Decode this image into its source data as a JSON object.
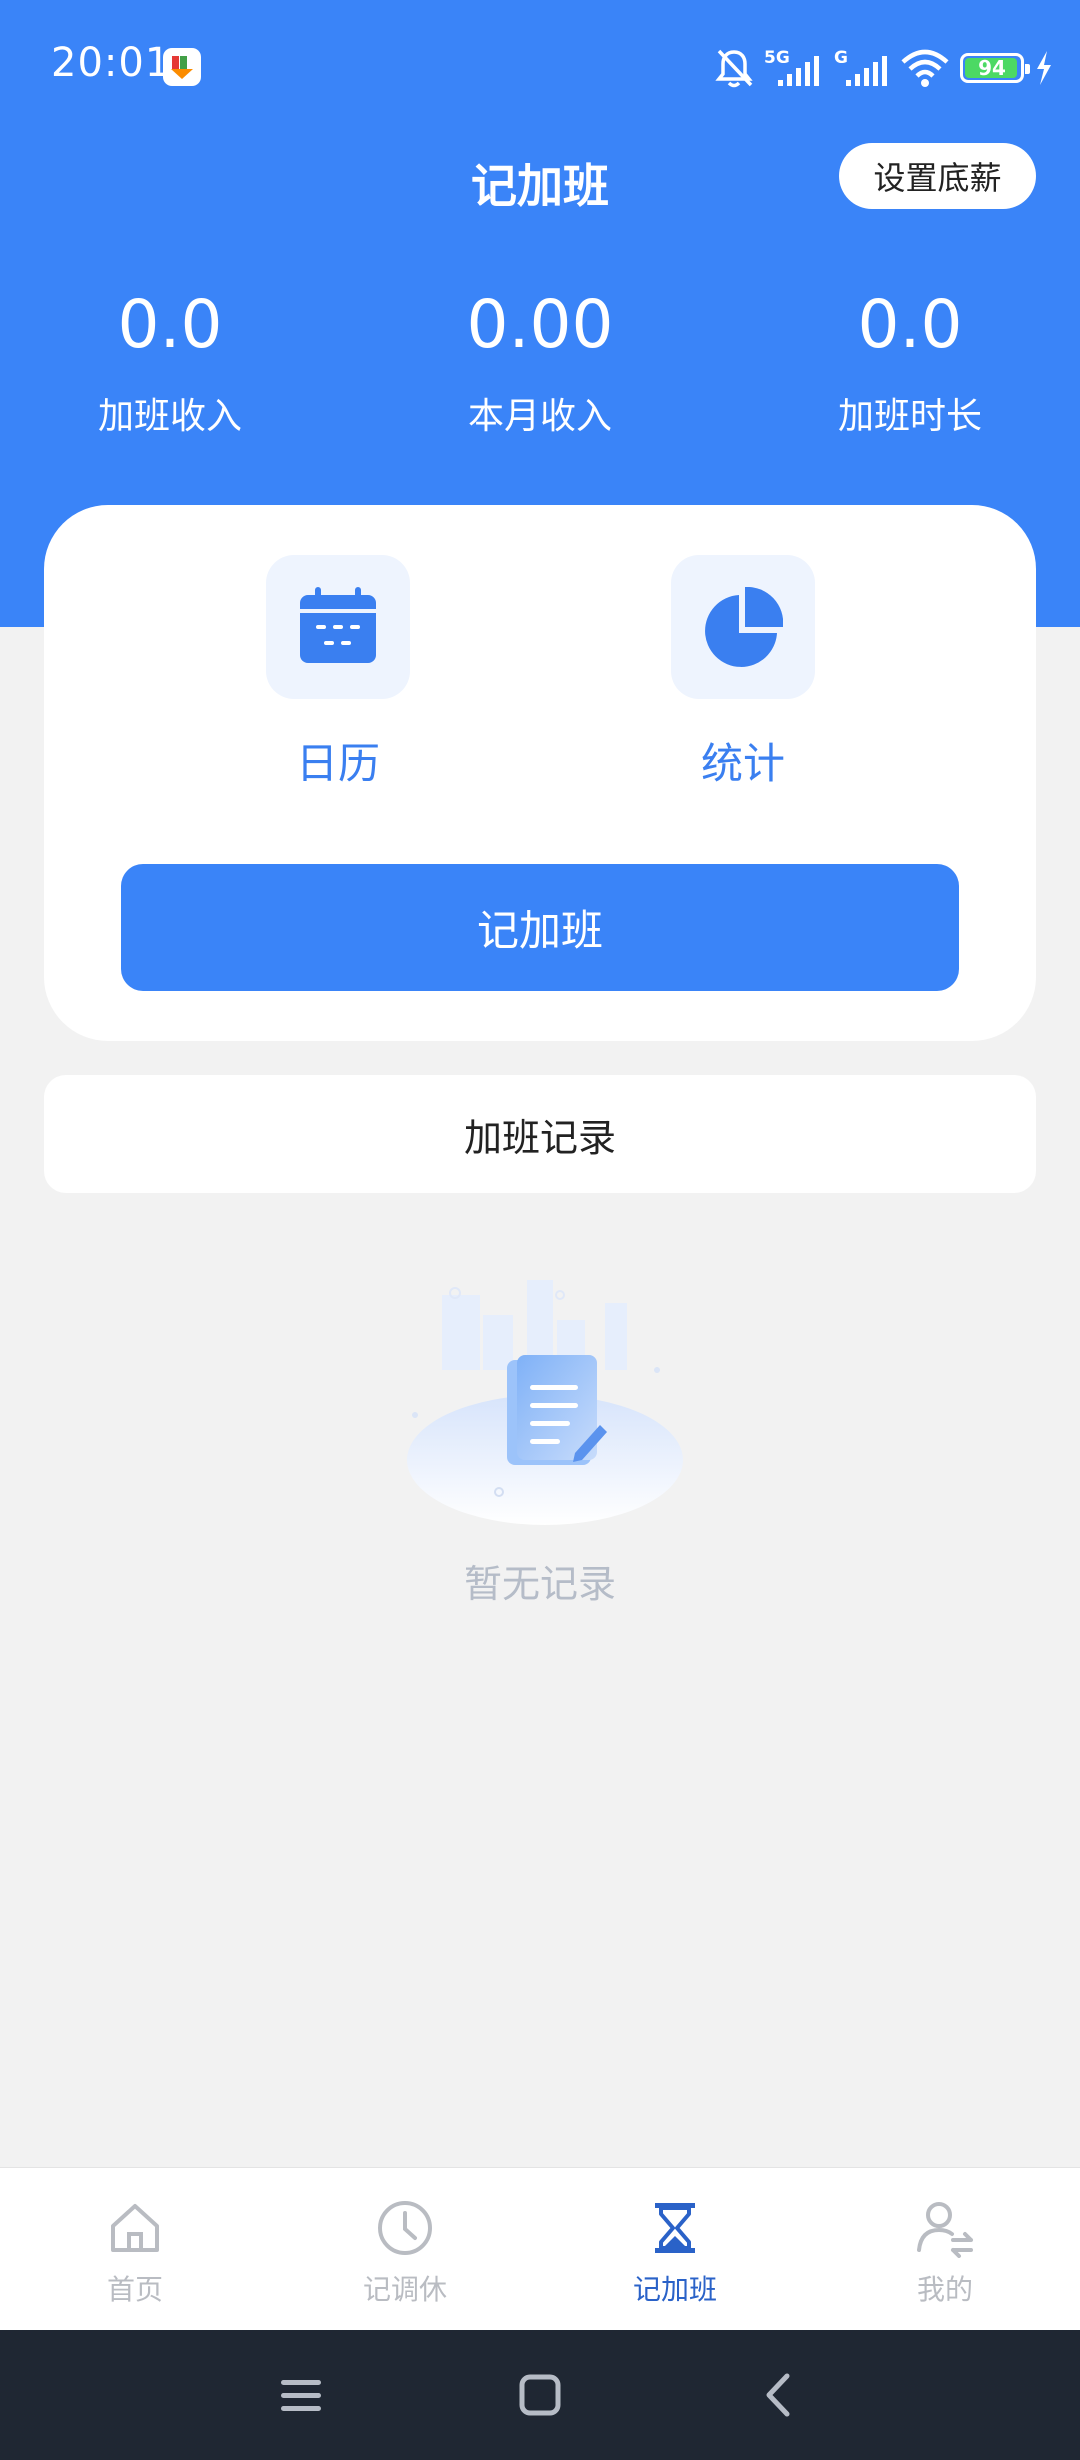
{
  "status_bar": {
    "time": "20:01",
    "battery_level": "94",
    "network_1": "5G",
    "network_2": "G",
    "icons": [
      "app-notification-icon",
      "mute-bell-icon",
      "signal-5g-icon",
      "signal-g-icon",
      "wifi-icon",
      "battery-icon",
      "charging-bolt-icon"
    ]
  },
  "header": {
    "title": "记加班",
    "set_salary_button": "设置底薪"
  },
  "stats": [
    {
      "value": "0.0",
      "label": "加班收入"
    },
    {
      "value": "0.00",
      "label": "本月收入"
    },
    {
      "value": "0.0",
      "label": "加班时长"
    }
  ],
  "actions": {
    "calendar_label": "日历",
    "statistics_label": "统计",
    "log_overtime_button": "记加班"
  },
  "records": {
    "section_title": "加班记录",
    "empty_text": "暂无记录"
  },
  "bottom_nav": [
    {
      "label": "首页",
      "icon": "home-icon",
      "active": false
    },
    {
      "label": "记调休",
      "icon": "clock-icon",
      "active": false
    },
    {
      "label": "记加班",
      "icon": "hourglass-icon",
      "active": true
    },
    {
      "label": "我的",
      "icon": "user-switch-icon",
      "active": false
    }
  ],
  "colors": {
    "primary": "#3a84f8",
    "background": "#f2f2f2",
    "nav_active": "#2a62c8",
    "nav_inactive": "#b9bcc2",
    "system_nav": "#1f2733"
  }
}
